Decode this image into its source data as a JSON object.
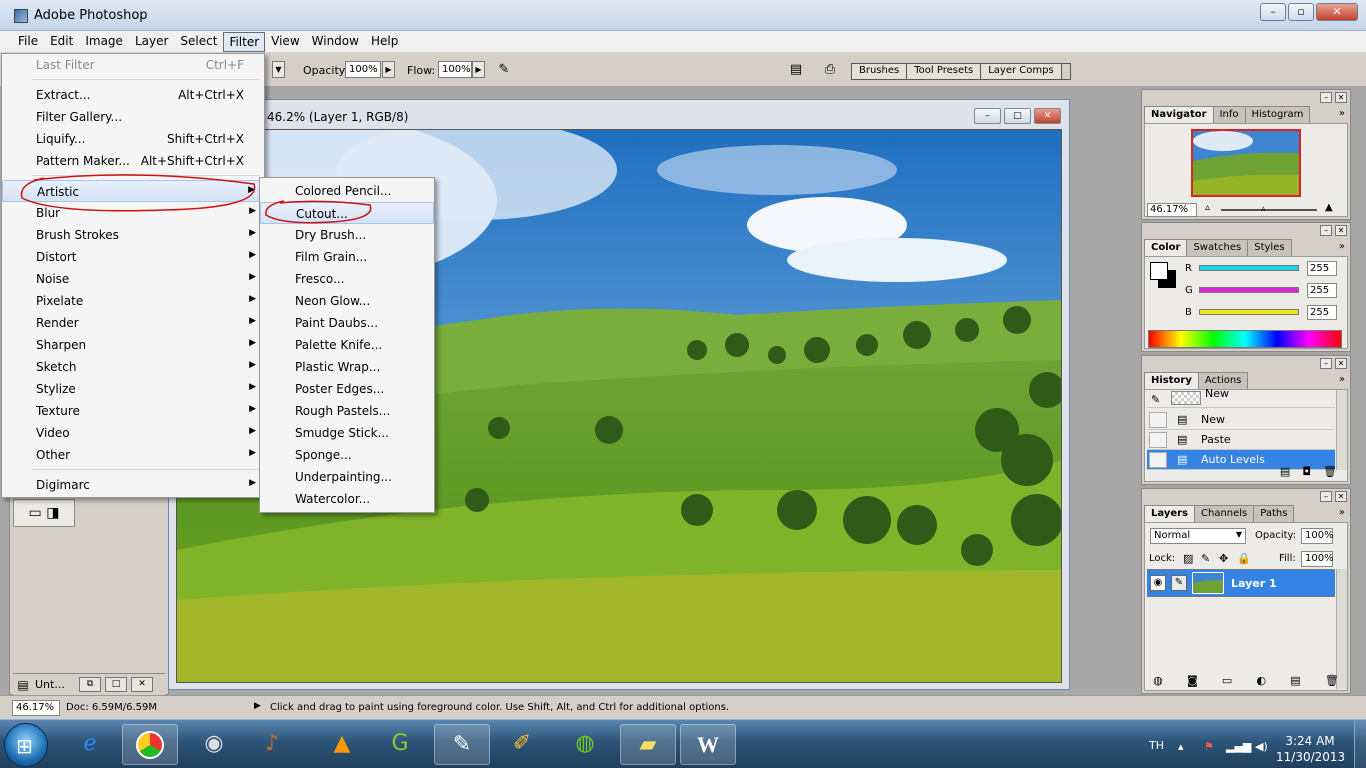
{
  "window": {
    "title": "Adobe Photoshop"
  },
  "menubar": [
    "File",
    "Edit",
    "Image",
    "Layer",
    "Select",
    "Filter",
    "View",
    "Window",
    "Help"
  ],
  "options": {
    "opacity_label": "Opacity:",
    "opacity_value": "100%",
    "flow_label": "Flow:",
    "flow_value": "100%",
    "palette_well": [
      "Brushes",
      "Tool Presets",
      "Layer Comps"
    ]
  },
  "filter_menu": {
    "items": [
      {
        "label": "Last Filter",
        "shortcut": "Ctrl+F",
        "disabled": true
      },
      {
        "label": "Extract...",
        "shortcut": "Alt+Ctrl+X"
      },
      {
        "label": "Filter Gallery...",
        "shortcut": ""
      },
      {
        "label": "Liquify...",
        "shortcut": "Shift+Ctrl+X"
      },
      {
        "label": "Pattern Maker...",
        "shortcut": "Alt+Shift+Ctrl+X"
      },
      {
        "label": "Artistic",
        "submenu": true
      },
      {
        "label": "Blur",
        "submenu": true
      },
      {
        "label": "Brush Strokes",
        "submenu": true
      },
      {
        "label": "Distort",
        "submenu": true
      },
      {
        "label": "Noise",
        "submenu": true
      },
      {
        "label": "Pixelate",
        "submenu": true
      },
      {
        "label": "Render",
        "submenu": true
      },
      {
        "label": "Sharpen",
        "submenu": true
      },
      {
        "label": "Sketch",
        "submenu": true
      },
      {
        "label": "Stylize",
        "submenu": true
      },
      {
        "label": "Texture",
        "submenu": true
      },
      {
        "label": "Video",
        "submenu": true
      },
      {
        "label": "Other",
        "submenu": true
      },
      {
        "label": "Digimarc",
        "submenu": true
      }
    ]
  },
  "artistic_menu": {
    "items": [
      "Colored Pencil...",
      "Cutout...",
      "Dry Brush...",
      "Film Grain...",
      "Fresco...",
      "Neon Glow...",
      "Paint Daubs...",
      "Palette Knife...",
      "Plastic Wrap...",
      "Poster Edges...",
      "Rough Pastels...",
      "Smudge Stick...",
      "Sponge...",
      "Underpainting...",
      "Watercolor..."
    ],
    "highlighted": "Cutout..."
  },
  "document": {
    "title": "46.2% (Layer 1, RGB/8)",
    "minimized_label": "Unt..."
  },
  "navigator": {
    "tabs": [
      "Navigator",
      "Info",
      "Histogram"
    ],
    "zoom": "46.17%"
  },
  "color": {
    "tabs": [
      "Color",
      "Swatches",
      "Styles"
    ],
    "channels": [
      {
        "name": "R",
        "value": "255",
        "color": "#19d7e8"
      },
      {
        "name": "G",
        "value": "255",
        "color": "#d92cd4"
      },
      {
        "name": "B",
        "value": "255",
        "color": "#f0e61a"
      }
    ]
  },
  "history": {
    "tabs": [
      "History",
      "Actions"
    ],
    "snapshot": "New",
    "steps": [
      "New",
      "Paste",
      "Auto Levels"
    ],
    "selected": "Auto Levels"
  },
  "layers": {
    "tabs": [
      "Layers",
      "Channels",
      "Paths"
    ],
    "blend_mode": "Normal",
    "opacity_label": "Opacity:",
    "opacity": "100%",
    "lock_label": "Lock:",
    "fill_label": "Fill:",
    "fill": "100%",
    "layer_name": "Layer 1"
  },
  "status": {
    "zoom": "46.17%",
    "doc": "Doc: 6.59M/6.59M",
    "message": "Click and drag to paint using foreground color.  Use Shift, Alt, and Ctrl for additional options."
  },
  "taskbar": {
    "lang": "TH",
    "time": "3:24 AM",
    "date": "11/30/2013",
    "apps": [
      "ie-icon",
      "chrome-icon",
      "folder-cam-icon",
      "violin-icon",
      "vlc-icon",
      "greenshot-icon",
      "photoshop-icon",
      "paint-icon",
      "globe-icon",
      "explorer-icon",
      "word-icon"
    ]
  },
  "colors": {
    "highlight": "#3584e4",
    "annotation": "#d01010"
  }
}
